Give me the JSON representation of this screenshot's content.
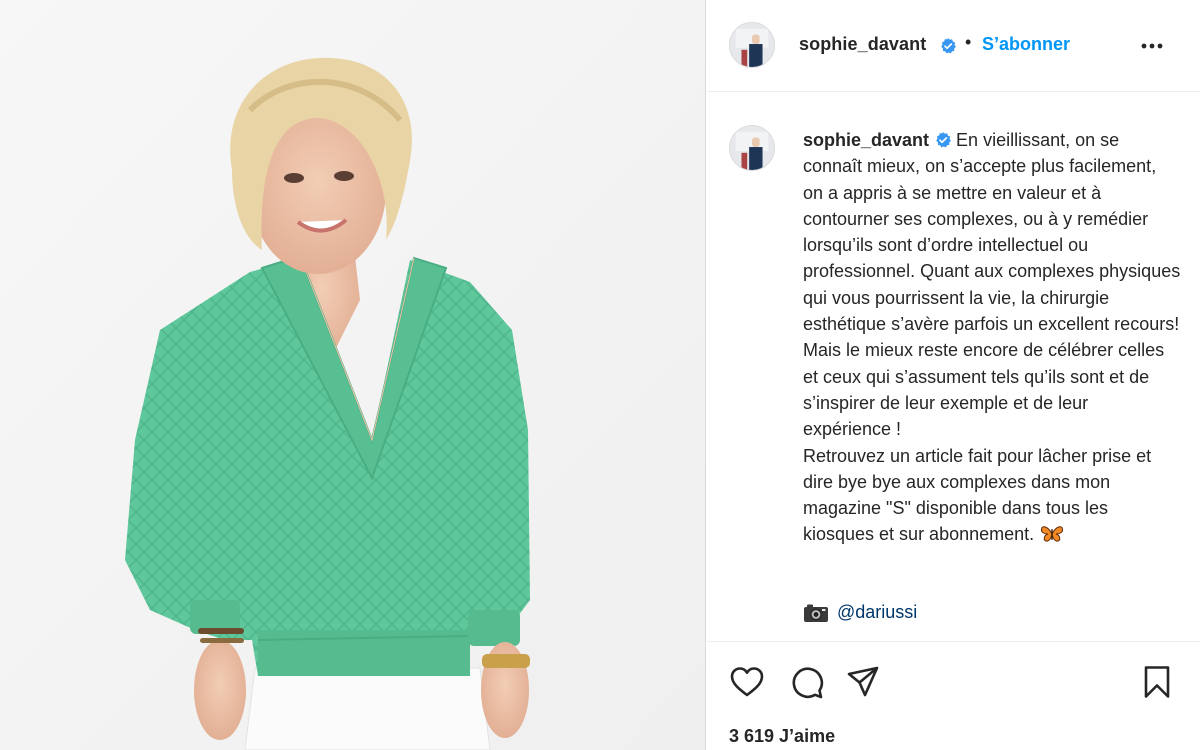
{
  "post": {
    "username": "sophie_davant",
    "follow_label": "S’abonner",
    "separator": "•",
    "caption": "En vieillissant, on se connaît mieux, on s’accepte plus facilement, on a appris à se mettre en valeur et à contourner ses complexes, ou à y remédier lorsqu’ils sont d’ordre intellectuel ou professionnel. Quant aux complexes physiques qui vous pourrissent la vie, la chirurgie esthétique s’avère parfois un excellent recours! Mais le mieux reste encore de célébrer celles et ceux qui s’assument tels qu’ils sont et de s’inspirer de leur exemple et de leur expérience !\nRetrouvez un article fait pour lâcher prise et dire bye bye aux complexes dans mon magazine \"S\" disponible dans tous les kiosques et sur abonnement.",
    "photo_credit": "@dariussi",
    "likes": "3 619 J’aime"
  },
  "icons": {
    "verified": "verified-badge-icon",
    "more": "more-options-icon",
    "butterfly": "butterfly-emoji",
    "camera": "camera-emoji",
    "like": "heart-icon",
    "comment": "comment-icon",
    "share": "share-icon",
    "save": "bookmark-icon"
  },
  "colors": {
    "accent": "#0095f6",
    "verified": "#3897f0",
    "sweater": "#5ec79b",
    "background_photo": "#f4f4f4"
  }
}
